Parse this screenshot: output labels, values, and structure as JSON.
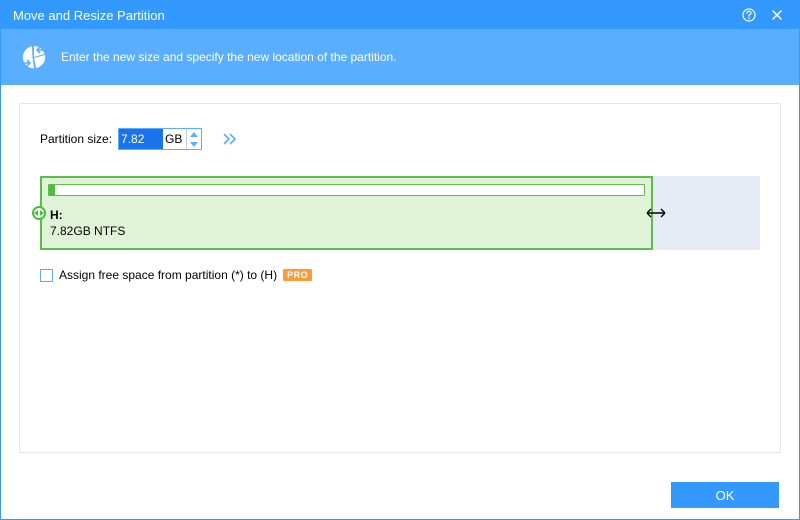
{
  "title": "Move and Resize Partition",
  "banner": {
    "text": "Enter the new size and specify the new location of the partition."
  },
  "sizeRow": {
    "label": "Partition size:",
    "value": "7.82",
    "unit": "GB"
  },
  "partition": {
    "drive": "H:",
    "meta": "7.82GB NTFS"
  },
  "assign": {
    "label": "Assign free space from partition (*) to (H)",
    "checked": false,
    "pro": "PRO"
  },
  "footer": {
    "ok": "OK"
  },
  "colors": {
    "accent": "#3399ff",
    "banner": "#59aeff",
    "partition": "#5fbb4f"
  }
}
